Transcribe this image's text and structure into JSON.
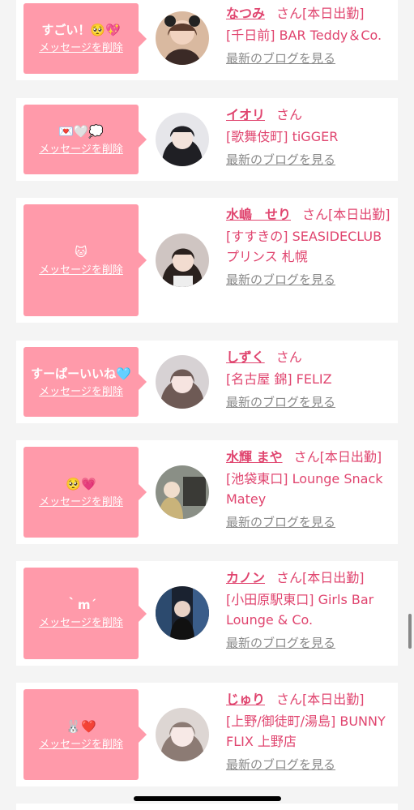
{
  "messages": [
    {
      "text": "すごい！🥺💖",
      "delete_label": "メッセージを削除",
      "name": "なつみ",
      "honorific": "さん",
      "status": "[本日出勤]",
      "shop": "[千日前] BAR Teddy＆Co.",
      "blog_link": "最新のブログを見る"
    },
    {
      "text": "💌🤍💭",
      "delete_label": "メッセージを削除",
      "name": "イオリ",
      "honorific": "さん",
      "status": "",
      "shop": "[歌舞伎町] tiGGER",
      "blog_link": "最新のブログを見る"
    },
    {
      "text": "🐱",
      "delete_label": "メッセージを削除",
      "name": "水嶋　せり",
      "honorific": "さん",
      "status": "[本日出勤]",
      "shop": "[すすきの] SEASIDECLUB プリンス 札幌",
      "blog_link": "最新のブログを見る"
    },
    {
      "text": "すーぱーいいね🩵",
      "delete_label": "メッセージを削除",
      "name": "しずく",
      "honorific": "さん",
      "status": "",
      "shop": "[名古屋 錦] FELIZ",
      "blog_link": "最新のブログを見る"
    },
    {
      "text": "🥺💗",
      "delete_label": "メッセージを削除",
      "name": "水輝 まや",
      "honorific": "さん",
      "status": "[本日出勤]",
      "shop": "[池袋東口] Lounge Snack Matey",
      "blog_link": "最新のブログを見る"
    },
    {
      "text": "｀m´",
      "delete_label": "メッセージを削除",
      "name": "カノン",
      "honorific": "さん",
      "status": "[本日出勤]",
      "shop": "[小田原駅東口] Girls Bar Lounge & Co.",
      "blog_link": "最新のブログを見る"
    },
    {
      "text": "🐰❤️",
      "delete_label": "メッセージを削除",
      "name": "じゅり",
      "honorific": "さん",
      "status": "[本日出勤]",
      "shop": "[上野/御徒町/湯島] BUNNY FLIX 上野店",
      "blog_link": "最新のブログを見る"
    }
  ]
}
